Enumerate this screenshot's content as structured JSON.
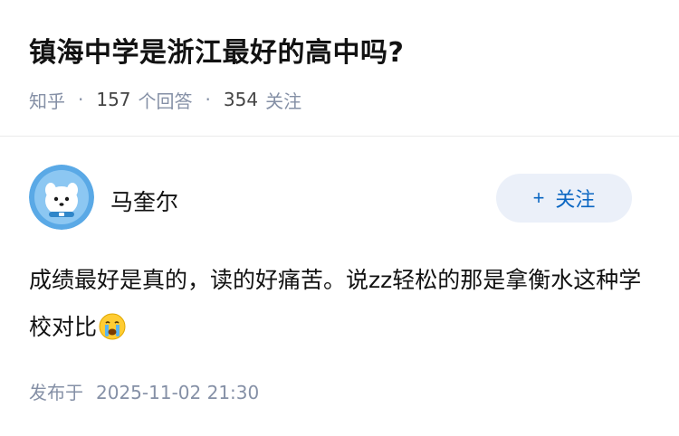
{
  "question": {
    "title": "镇海中学是浙江最好的高中吗?",
    "source": "知乎",
    "answers_count": "157",
    "answers_label": "个回答",
    "followers_count": "354",
    "followers_label": "关注"
  },
  "answer": {
    "author_name": "马奎尔",
    "follow_label": "关注",
    "follow_icon": "plus-icon",
    "text": "成绩最好是真的，读的好痛苦。说zz轻松的那是拿衡水这种学校对比",
    "emoji": "crying-face-emoji",
    "published_label": "发布于",
    "published_time": "2025-11-02 21:30"
  },
  "colors": {
    "accent": "#0a66c2",
    "follow_bg": "#ebf0f9",
    "meta_gray": "#8590a6",
    "avatar_bg": "#5aa9e6"
  }
}
